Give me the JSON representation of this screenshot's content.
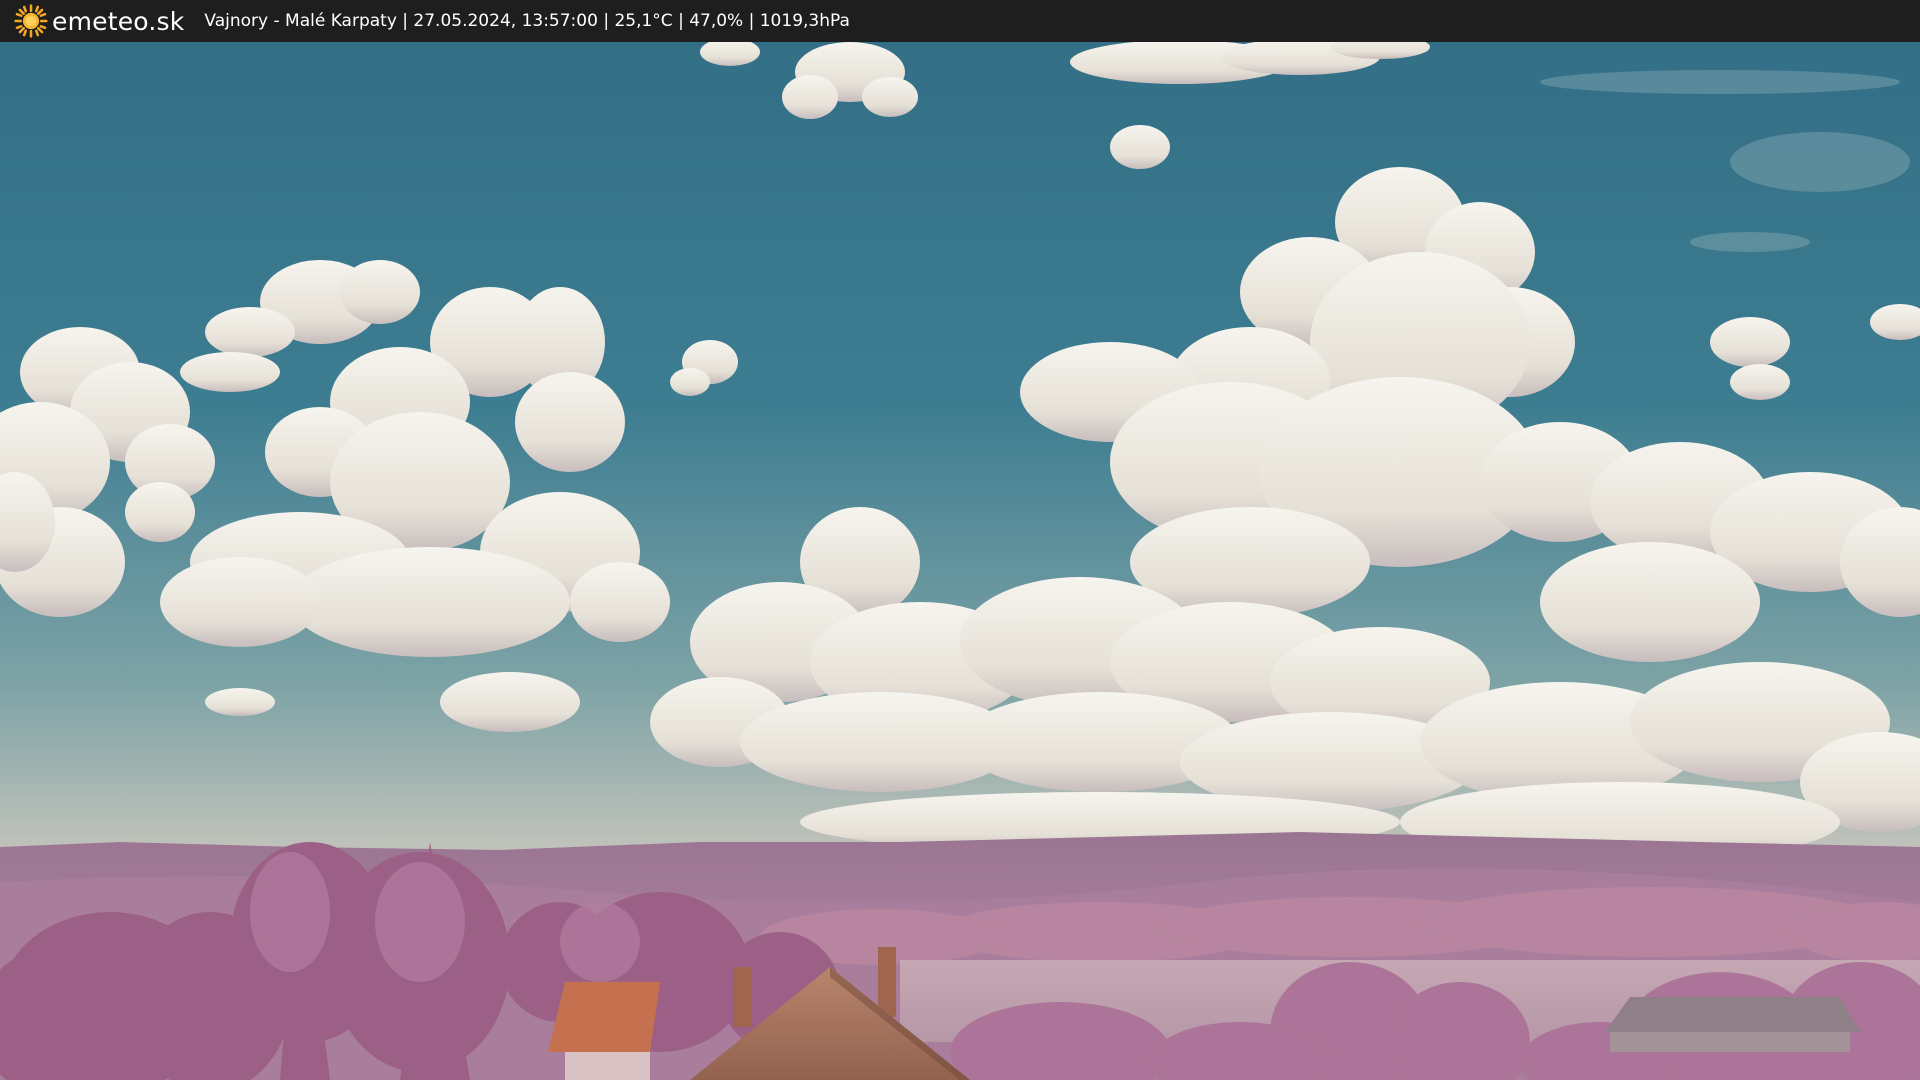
{
  "header": {
    "brand": "emeteo.sk",
    "caption": "Vajnory - Malé Karpaty | 27.05.2024, 13:57:00 | 25,1°C | 47,0% | 1019,3hPa",
    "logo_icon": "sun-icon",
    "logo_color": "#f5a623"
  },
  "scene": {
    "description_icon": "webcam-image",
    "sky_color": "#3e7f93",
    "cloud_color": "#efeee6",
    "foliage_color": "#a56e95",
    "roof_color": "#c5714f"
  }
}
